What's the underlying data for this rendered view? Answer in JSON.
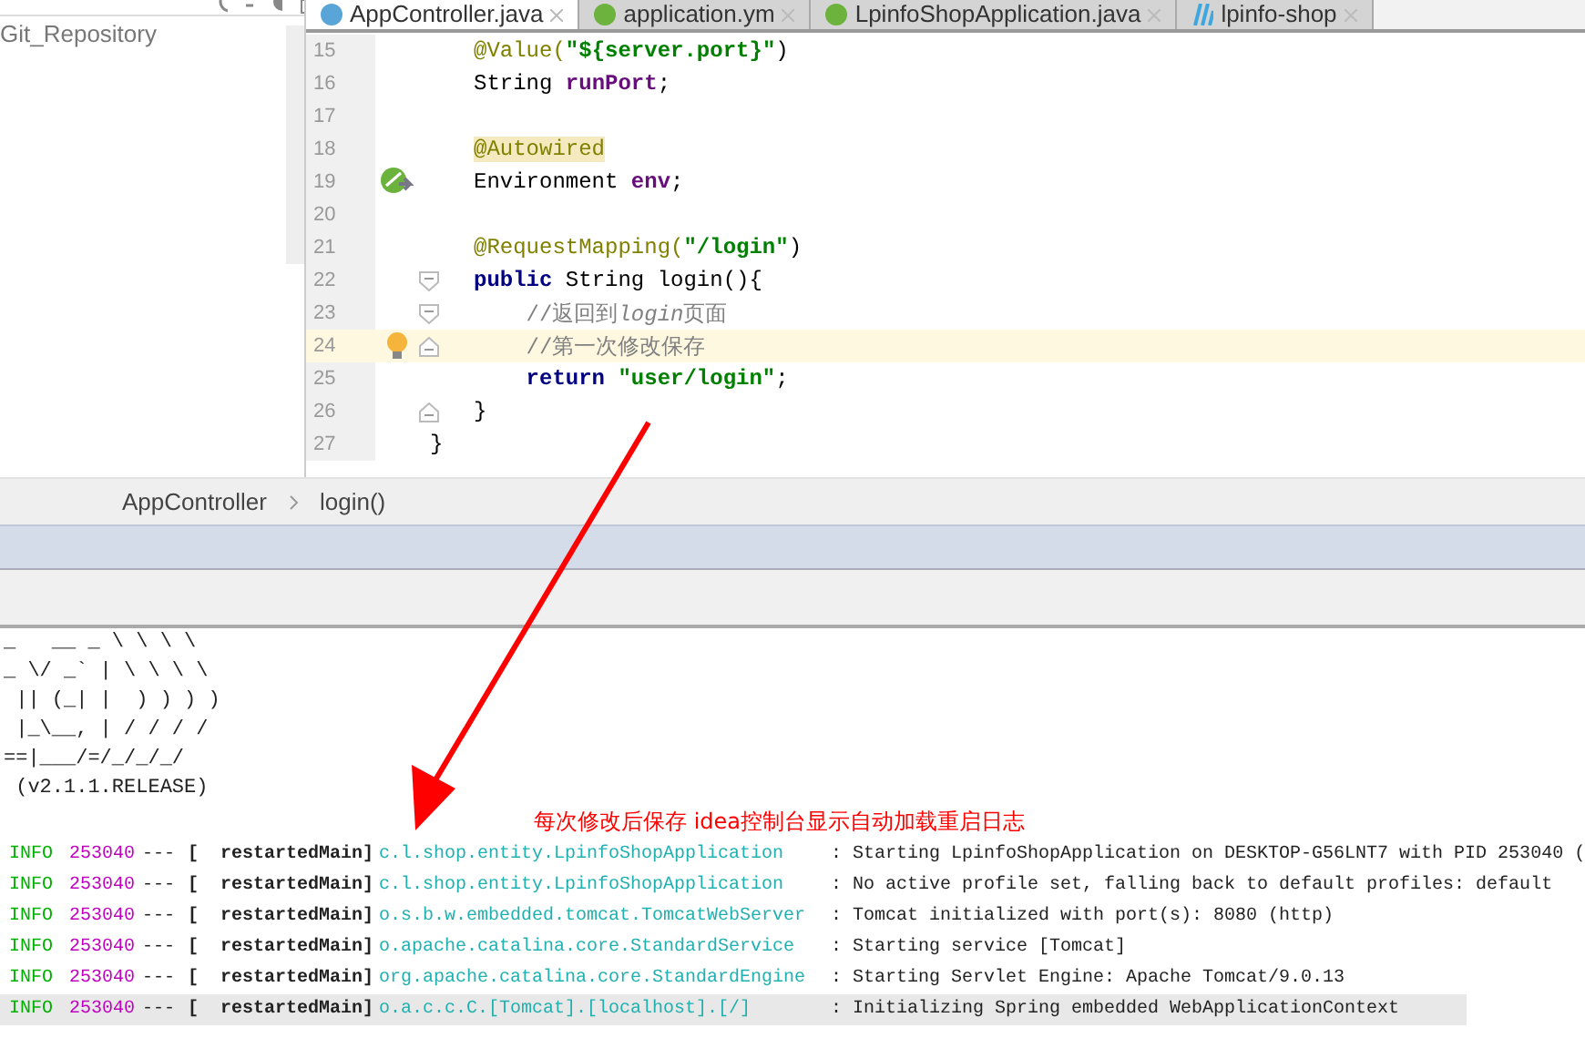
{
  "project_panel": {
    "root_label": "Git_Repository"
  },
  "tabs": [
    {
      "label": "AppController.java",
      "selected": true,
      "kind": "class"
    },
    {
      "label": "application.ym",
      "selected": false,
      "kind": "spring"
    },
    {
      "label": "LpinfoShopApplication.java",
      "selected": false,
      "kind": "spring"
    },
    {
      "label": "lpinfo-shop",
      "selected": false,
      "kind": "module"
    }
  ],
  "editor": {
    "lines": [
      {
        "number": "15",
        "current": false,
        "kind": "plain",
        "tokens": [
          {
            "text": "@Value(",
            "kind": "annotation"
          },
          {
            "text": "\"${server.port}\"",
            "kind": "string"
          },
          {
            "text": ")",
            "kind": "plain"
          }
        ]
      },
      {
        "number": "16",
        "current": false,
        "kind": "plain",
        "tokens": [
          {
            "text": "String ",
            "kind": "plain"
          },
          {
            "text": "runPort",
            "kind": "field"
          },
          {
            "text": ";",
            "kind": "plain"
          }
        ]
      },
      {
        "number": "17",
        "current": false,
        "kind": "plain"
      },
      {
        "number": "18",
        "current": false,
        "kind": "plain",
        "tokens": [
          {
            "text": "@Autowired",
            "kind": "annotation-highlight"
          }
        ]
      },
      {
        "number": "19",
        "current": false,
        "kind": "bean",
        "tokens": [
          {
            "text": "Environment ",
            "kind": "plain"
          },
          {
            "text": "env",
            "kind": "field"
          },
          {
            "text": ";",
            "kind": "plain"
          }
        ]
      },
      {
        "number": "20",
        "current": false,
        "kind": "plain"
      },
      {
        "number": "21",
        "current": false,
        "kind": "plain",
        "tokens": [
          {
            "text": "@RequestMapping(",
            "kind": "annotation"
          },
          {
            "text": "\"/login\"",
            "kind": "string"
          },
          {
            "text": ")",
            "kind": "plain"
          }
        ]
      },
      {
        "number": "22",
        "current": false,
        "fold_start": true,
        "kind": "plain",
        "tokens": [
          {
            "text": "public ",
            "kind": "keyword"
          },
          {
            "text": "String login(){",
            "kind": "plain"
          }
        ]
      },
      {
        "number": "23",
        "current": false,
        "fold_start": true,
        "kind": "plain",
        "tokens": [
          {
            "text": "    //返回到",
            "kind": "comment"
          },
          {
            "text": "login",
            "kind": "comment-italic"
          },
          {
            "text": "页面",
            "kind": "comment"
          }
        ]
      },
      {
        "number": "24",
        "current": true,
        "fold_end": true,
        "kind": "bulb",
        "tokens": [
          {
            "text": "    //第一次修改保存",
            "kind": "comment"
          }
        ]
      },
      {
        "number": "25",
        "current": false,
        "kind": "plain",
        "tokens": [
          {
            "text": "    return ",
            "kind": "keyword"
          },
          {
            "text": "\"user/login\"",
            "kind": "string"
          },
          {
            "text": ";",
            "kind": "plain"
          }
        ]
      },
      {
        "number": "26",
        "current": false,
        "fold_end": true,
        "kind": "plain",
        "tokens": [
          {
            "text": "}",
            "kind": "plain"
          }
        ]
      },
      {
        "number": "27",
        "current": false,
        "kind": "plain",
        "tokens": [
          {
            "text": "}",
            "kind": "outer"
          }
        ]
      }
    ]
  },
  "breadcrumbs": [
    "AppController",
    "login()"
  ],
  "console": {
    "banner": [
      "_   __ _ \\ \\ \\ \\",
      "_ \\/ _` | \\ \\ \\ \\",
      " || (_| |  ) ) ) )",
      " |_\\__, | / / / /",
      "==|___/=/_/_/_/"
    ],
    "version": " (v2.1.1.RELEASE)",
    "annotation": "每次修改后保存 idea控制台显示自动加载重启日志",
    "logs": [
      {
        "level": "INFO",
        "pid": "253040",
        "sep": "---",
        "thread": "[  restartedMain]",
        "logger": "c.l.shop.entity.LpinfoShopApplication",
        "message": ": Starting LpinfoShopApplication on DESKTOP-G56LNT7 with PID 253040 (",
        "selected": false
      },
      {
        "level": "INFO",
        "pid": "253040",
        "sep": "---",
        "thread": "[  restartedMain]",
        "logger": "c.l.shop.entity.LpinfoShopApplication",
        "message": ": No active profile set, falling back to default profiles: default",
        "selected": false
      },
      {
        "level": "INFO",
        "pid": "253040",
        "sep": "---",
        "thread": "[  restartedMain]",
        "logger": "o.s.b.w.embedded.tomcat.TomcatWebServer",
        "message": ": Tomcat initialized with port(s): 8080 (http)",
        "selected": false
      },
      {
        "level": "INFO",
        "pid": "253040",
        "sep": "---",
        "thread": "[  restartedMain]",
        "logger": "o.apache.catalina.core.StandardService",
        "message": ": Starting service [Tomcat]",
        "selected": false
      },
      {
        "level": "INFO",
        "pid": "253040",
        "sep": "---",
        "thread": "[  restartedMain]",
        "logger": "org.apache.catalina.core.StandardEngine",
        "message": ": Starting Servlet Engine: Apache Tomcat/9.0.13",
        "selected": false
      },
      {
        "level": "INFO",
        "pid": "253040",
        "sep": "---",
        "thread": "[  restartedMain]",
        "logger": "o.a.c.c.C.[Tomcat].[localhost].[/]",
        "message": ": Initializing Spring embedded WebApplicationContext",
        "selected": true
      }
    ]
  }
}
